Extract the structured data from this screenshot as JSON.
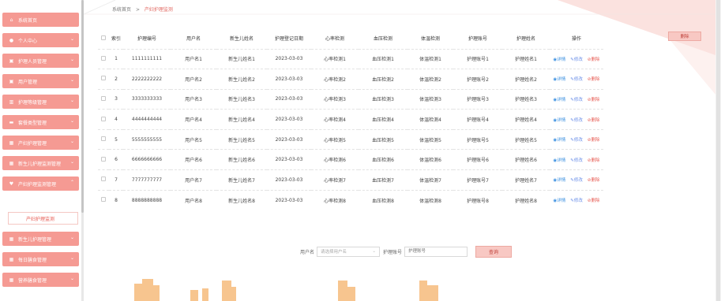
{
  "sidebar": {
    "items": [
      {
        "label": "系统首页",
        "icon": "home-icon",
        "glyph": "⌂",
        "name": "sidebar-item-home"
      },
      {
        "label": "个人中心",
        "icon": "user-icon",
        "glyph": "●",
        "name": "sidebar-item-personal"
      },
      {
        "label": "护理人员管理",
        "icon": "nurse-icon",
        "glyph": "▣",
        "name": "sidebar-item-nurse-staff"
      },
      {
        "label": "用户管理",
        "icon": "users-icon",
        "glyph": "▣",
        "name": "sidebar-item-users"
      },
      {
        "label": "护理等级管理",
        "icon": "level-icon",
        "glyph": "▥",
        "name": "sidebar-item-care-level"
      },
      {
        "label": "套餐类型管理",
        "icon": "package-icon",
        "glyph": "▬",
        "name": "sidebar-item-package-type"
      },
      {
        "label": "产妇护理管理",
        "icon": "grid-icon",
        "glyph": "▦",
        "name": "sidebar-item-maternal-care"
      },
      {
        "label": "新生儿护理监测管理",
        "icon": "grid-icon",
        "glyph": "▦",
        "name": "sidebar-item-newborn-monitor"
      },
      {
        "label": "产妇护理监测管理",
        "icon": "heart-icon",
        "glyph": "♥",
        "name": "sidebar-item-maternal-monitor"
      },
      {
        "label": "新生儿护理管理",
        "icon": "grid-icon",
        "glyph": "▦",
        "name": "sidebar-item-newborn-care"
      },
      {
        "label": "每日膳食管理",
        "icon": "grid-icon",
        "glyph": "▦",
        "name": "sidebar-item-daily-meal"
      },
      {
        "label": "营养膳食管理",
        "icon": "grid-icon",
        "glyph": "▦",
        "name": "sidebar-item-nutrition"
      }
    ],
    "sub_item": "产妇护理监测"
  },
  "breadcrumb": {
    "home": "系统首页",
    "sep": ">",
    "current": "产妇护理监测"
  },
  "delete_button": "删除",
  "table": {
    "headers": [
      "索引",
      "护理编号",
      "用户名",
      "新生儿姓名",
      "护理登记日期",
      "心率检测",
      "血压检测",
      "体温检测",
      "护理账号",
      "护理姓名",
      "操作"
    ],
    "rows": [
      [
        "1",
        "1111111111",
        "用户名1",
        "新生儿姓名1",
        "2023-03-03",
        "心率检测1",
        "血压检测1",
        "体温检测1",
        "护理账号1",
        "护理姓名1"
      ],
      [
        "2",
        "2222222222",
        "用户名2",
        "新生儿姓名2",
        "2023-03-03",
        "心率检测2",
        "血压检测2",
        "体温检测2",
        "护理账号2",
        "护理姓名2"
      ],
      [
        "3",
        "3333333333",
        "用户名3",
        "新生儿姓名3",
        "2023-03-03",
        "心率检测3",
        "血压检测3",
        "体温检测3",
        "护理账号3",
        "护理姓名3"
      ],
      [
        "4",
        "4444444444",
        "用户名4",
        "新生儿姓名4",
        "2023-03-03",
        "心率检测4",
        "血压检测4",
        "体温检测4",
        "护理账号4",
        "护理姓名4"
      ],
      [
        "5",
        "5555555555",
        "用户名5",
        "新生儿姓名5",
        "2023-03-03",
        "心率检测5",
        "血压检测5",
        "体温检测5",
        "护理账号5",
        "护理姓名5"
      ],
      [
        "6",
        "6666666666",
        "用户名6",
        "新生儿姓名6",
        "2023-03-03",
        "心率检测6",
        "血压检测6",
        "体温检测6",
        "护理账号6",
        "护理姓名6"
      ],
      [
        "7",
        "7777777777",
        "用户名7",
        "新生儿姓名7",
        "2023-03-03",
        "心率检测7",
        "血压检测7",
        "体温检测7",
        "护理账号7",
        "护理姓名7"
      ],
      [
        "8",
        "8888888888",
        "用户名8",
        "新生儿姓名8",
        "2023-03-03",
        "心率检测8",
        "血压检测8",
        "体温检测8",
        "护理账号8",
        "护理姓名8"
      ]
    ],
    "actions": {
      "view": "详情",
      "edit": "修改",
      "delete": "删除"
    }
  },
  "search": {
    "username_label": "用户名",
    "username_placeholder": "请选择用户名",
    "account_label": "护理账号",
    "account_placeholder": "护理账号",
    "query_button": "查询"
  },
  "colors": {
    "accent": "#f59a93",
    "accent_text": "#e75d55",
    "link": "#3a8fe0",
    "building": "#f7c58f"
  }
}
